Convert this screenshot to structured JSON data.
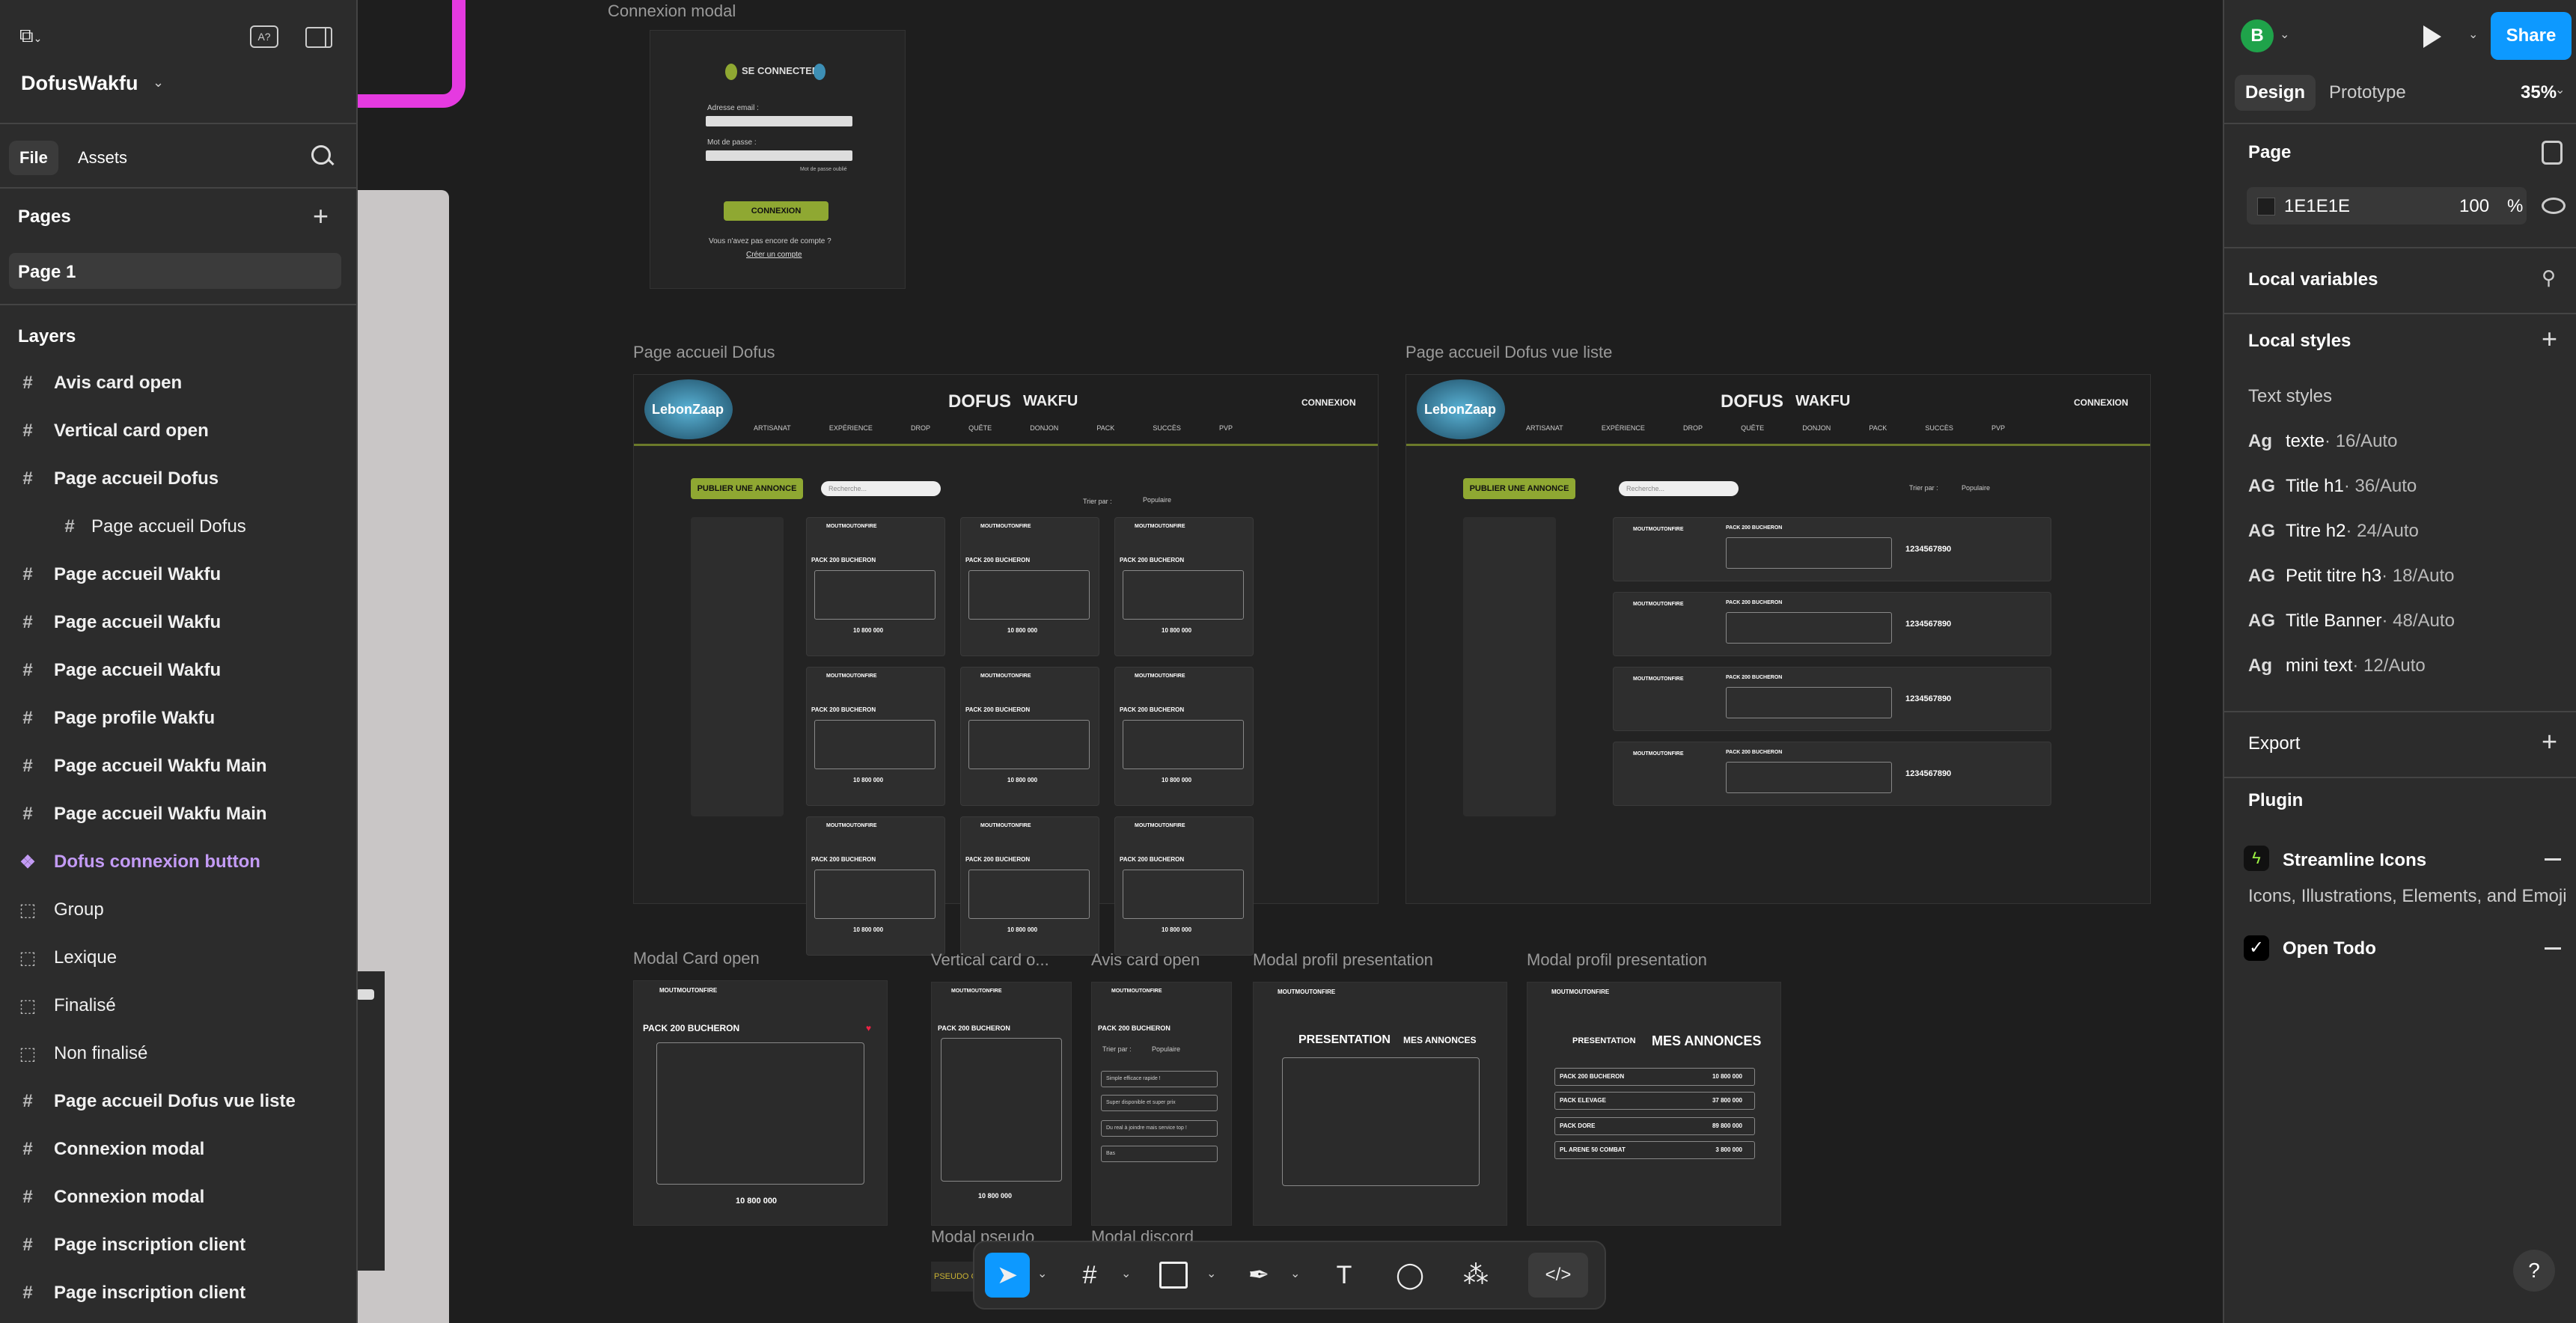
{
  "app": {
    "file_name": "DofusWakfu"
  },
  "left_panel": {
    "tabs": [
      "File",
      "Assets"
    ],
    "pages_title": "Pages",
    "pages": [
      "Page 1"
    ],
    "layers_title": "Layers",
    "layers": [
      {
        "label": "Avis card open",
        "type": "frame"
      },
      {
        "label": "Vertical card open",
        "type": "frame"
      },
      {
        "label": "Page accueil Dofus",
        "type": "frame"
      },
      {
        "label": "Page accueil Dofus",
        "type": "frame",
        "child": true
      },
      {
        "label": "Page accueil Wakfu",
        "type": "frame"
      },
      {
        "label": "Page accueil Wakfu",
        "type": "frame"
      },
      {
        "label": "Page accueil Wakfu",
        "type": "frame"
      },
      {
        "label": "Page profile Wakfu",
        "type": "frame"
      },
      {
        "label": "Page accueil Wakfu Main",
        "type": "frame"
      },
      {
        "label": "Page accueil Wakfu Main",
        "type": "frame"
      },
      {
        "label": "Dofus connexion button",
        "type": "component"
      },
      {
        "label": "Group",
        "type": "group"
      },
      {
        "label": "Lexique",
        "type": "group"
      },
      {
        "label": "Finalisé",
        "type": "group"
      },
      {
        "label": "Non finalisé",
        "type": "group"
      },
      {
        "label": "Page accueil Dofus vue liste",
        "type": "frame"
      },
      {
        "label": "Connexion modal",
        "type": "frame"
      },
      {
        "label": "Connexion modal",
        "type": "frame"
      },
      {
        "label": "Page inscription client",
        "type": "frame"
      },
      {
        "label": "Page inscription client",
        "type": "frame"
      }
    ]
  },
  "right_panel": {
    "avatar_letter": "B",
    "share_label": "Share",
    "tabs": [
      "Design",
      "Prototype"
    ],
    "zoom": "35%",
    "page_title": "Page",
    "page_color": "1E1E1E",
    "page_opacity": "100",
    "page_opacity_unit": "%",
    "local_variables": "Local variables",
    "local_styles": "Local styles",
    "text_styles_title": "Text styles",
    "text_styles": [
      {
        "ag": "Ag",
        "name": "texte",
        "detail": " · 16/Auto"
      },
      {
        "ag": "AG",
        "name": "Title h1",
        "detail": " · 36/Auto"
      },
      {
        "ag": "AG",
        "name": "Titre h2",
        "detail": " · 24/Auto"
      },
      {
        "ag": "AG",
        "name": "Petit titre h3",
        "detail": " · 18/Auto"
      },
      {
        "ag": "AG",
        "name": "Title Banner",
        "detail": " · 48/Auto"
      },
      {
        "ag": "Ag",
        "name": "mini text",
        "detail": " · 12/Auto"
      }
    ],
    "export_title": "Export",
    "plugin_title": "Plugin",
    "plugins": [
      {
        "name": "Streamline Icons",
        "desc": "Icons, Illustrations, Elements, and Emoji"
      },
      {
        "name": "Open Todo"
      }
    ]
  },
  "canvas": {
    "frames": {
      "connexion_modal": "Connexion modal",
      "accueil_dofus": "Page accueil Dofus",
      "accueil_dofus_liste": "Page accueil Dofus vue liste",
      "modal_card_open": "Modal Card open",
      "vertical_card": "Vertical card o...",
      "avis_card": "Avis card open",
      "modal_profil_1": "Modal profil presentation",
      "modal_profil_2": "Modal profil presentation",
      "modal_pseudo": "Modal pseudo",
      "modal_discord": "Modal discord"
    },
    "connexion": {
      "title": "SE CONNECTER",
      "email_label": "Adresse email :",
      "password_label": "Mot de passe :",
      "forgot": "Mot de passe oublié",
      "button": "CONNEXION",
      "no_account": "Vous n'avez pas encore de compte ?",
      "create": "Créer un compte"
    },
    "site": {
      "logo": "LebonZaap",
      "brand": "DOFUS",
      "brand2": "WAKFU",
      "login": "CONNEXION",
      "nav": [
        "ARTISANAT",
        "EXPÉRIENCE",
        "DROP",
        "QUÊTE",
        "DONJON",
        "PACK",
        "SUCCÈS",
        "PVP"
      ],
      "publish": "PUBLIER UNE ANNONCE",
      "search_placeholder": "Recherche...",
      "sort_label": "Trier par :",
      "sort_value": "Populaire",
      "seller": "MOUTMOUTONFIRE",
      "card_title": "PACK 200 BUCHERON",
      "price": "10 800 000",
      "list_price": "1234567890"
    },
    "modal_card_title": "PACK 200 BUCHERON",
    "modal_card_price": "10 800 000",
    "avis_sort": "Populaire",
    "avis_sort_label": "Trier par :",
    "avis_options": [
      "Simple efficace rapide !",
      "Super disponible et super prix",
      "Du real à joindre mais service top !",
      "Bas"
    ],
    "profil_presentation": "PRESENTATION",
    "profil_annonces": "MES ANNONCES",
    "profil_rows": [
      {
        "name": "PACK 200 BUCHERON",
        "price": "10 800 000"
      },
      {
        "name": "PACK ELEVAGE",
        "price": "37 800 000"
      },
      {
        "name": "PACK DORE",
        "price": "89 800 000"
      },
      {
        "name": "PL ARENE 50 COMBAT",
        "price": "3 800 000"
      }
    ],
    "pseudo_label": "PSEUDO C"
  },
  "colors": {
    "accent": "#0d99ff",
    "component": "#c39bf5",
    "canvas": "#1e1e1e",
    "panel": "#2c2c2c",
    "site_green": "#8fa832",
    "magenta": "#e53ae0"
  }
}
